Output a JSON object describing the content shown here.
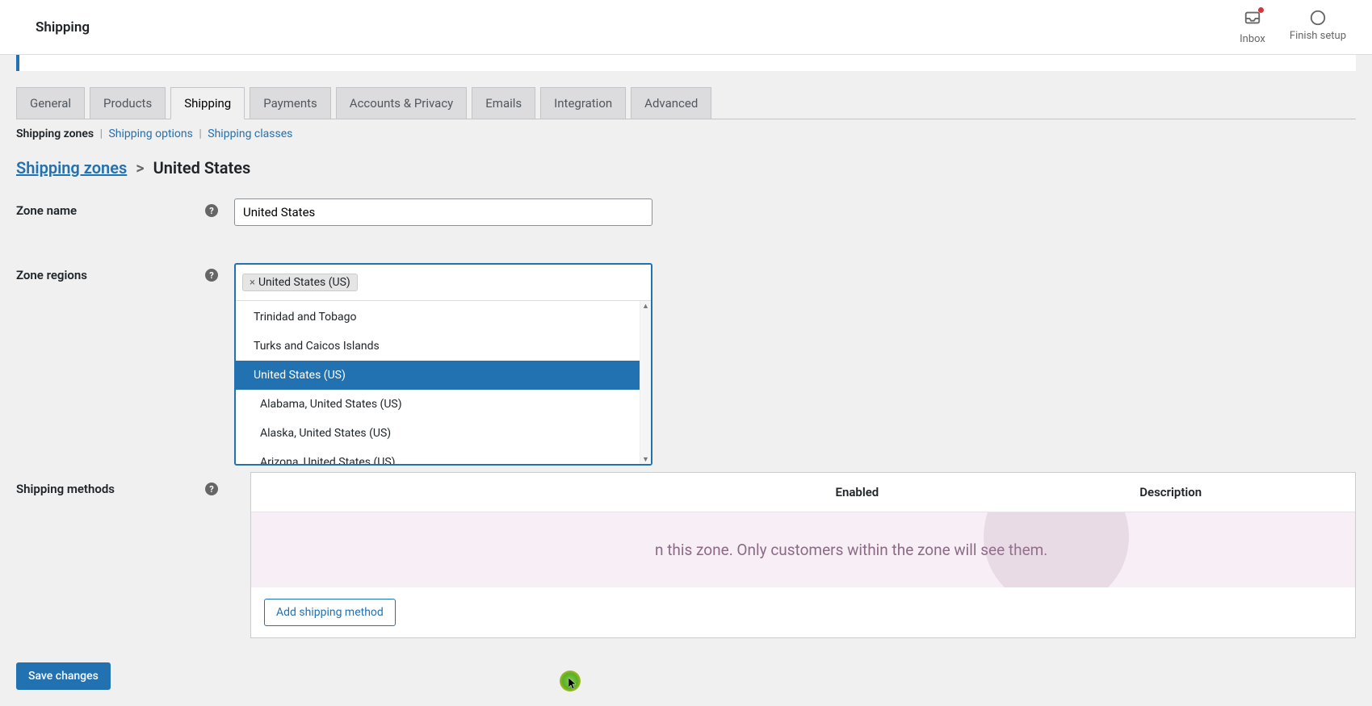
{
  "header": {
    "title": "Shipping",
    "inbox_label": "Inbox",
    "finish_label": "Finish setup"
  },
  "tabs": {
    "general": "General",
    "products": "Products",
    "shipping": "Shipping",
    "payments": "Payments",
    "accounts": "Accounts & Privacy",
    "emails": "Emails",
    "integration": "Integration",
    "advanced": "Advanced"
  },
  "subtabs": {
    "zones": "Shipping zones",
    "options": "Shipping options",
    "classes": "Shipping classes"
  },
  "breadcrumb": {
    "root": "Shipping zones",
    "current": "United States"
  },
  "form": {
    "zone_name_label": "Zone name",
    "zone_name_value": "United States",
    "zone_regions_label": "Zone regions",
    "selected_region": "United States (US)",
    "shipping_methods_label": "Shipping methods"
  },
  "dropdown": {
    "options": [
      "Trinidad and Tobago",
      "Turks and Caicos Islands",
      "United States (US)",
      "Alabama, United States (US)",
      "Alaska, United States (US)",
      "Arizona, United States (US)"
    ],
    "highlighted_index": 2
  },
  "methods_table": {
    "col_enabled": "Enabled",
    "col_description": "Description",
    "empty_text": "n this zone. Only customers within the zone will see them."
  },
  "buttons": {
    "add_method": "Add shipping method",
    "save": "Save changes"
  }
}
